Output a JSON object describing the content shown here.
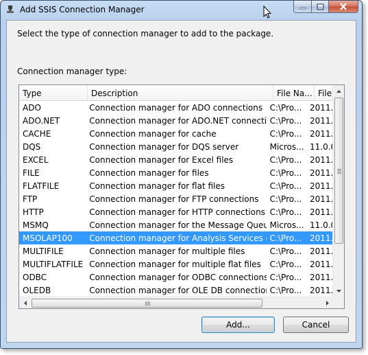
{
  "window": {
    "title": "Add SSIS Connection Manager"
  },
  "dialog": {
    "instruction": "Select the type of connection manager to add to the package.",
    "list_label": "Connection manager type:"
  },
  "list": {
    "columns": [
      "Type",
      "Description",
      "File Na...",
      "File V"
    ],
    "rows": [
      {
        "type": "ADO",
        "description": "Connection manager for ADO connections",
        "file_name": "C:\\Pro...",
        "file_version": "2011."
      },
      {
        "type": "ADO.NET",
        "description": "Connection manager for ADO.NET connections",
        "file_name": "C:\\Pro...",
        "file_version": "2011."
      },
      {
        "type": "CACHE",
        "description": "Connection manager for cache",
        "file_name": "C:\\Pro...",
        "file_version": "2011."
      },
      {
        "type": "DQS",
        "description": "Connection manager for DQS server",
        "file_name": "Micros...",
        "file_version": "11.0.0"
      },
      {
        "type": "EXCEL",
        "description": "Connection manager for Excel files",
        "file_name": "C:\\Pro...",
        "file_version": "2011."
      },
      {
        "type": "FILE",
        "description": "Connection manager for files",
        "file_name": "C:\\Pro...",
        "file_version": "2011."
      },
      {
        "type": "FLATFILE",
        "description": "Connection manager for flat files",
        "file_name": "C:\\Pro...",
        "file_version": "2011."
      },
      {
        "type": "FTP",
        "description": "Connection manager for FTP connections",
        "file_name": "C:\\Pro...",
        "file_version": "2011."
      },
      {
        "type": "HTTP",
        "description": "Connection manager for HTTP connections",
        "file_name": "C:\\Pro...",
        "file_version": "2011."
      },
      {
        "type": "MSMQ",
        "description": "Connection manager for the Message Queue t...",
        "file_name": "Micros...",
        "file_version": "11.0.0"
      },
      {
        "type": "MSOLAP100",
        "description": "Connection manager for Analysis Services con...",
        "file_name": "C:\\Pro...",
        "file_version": "2011."
      },
      {
        "type": "MULTIFILE",
        "description": "Connection manager for multiple files",
        "file_name": "C:\\Pro...",
        "file_version": "2011."
      },
      {
        "type": "MULTIFLATFILE",
        "description": "Connection manager for multiple flat files",
        "file_name": "C:\\Pro...",
        "file_version": "2011."
      },
      {
        "type": "ODBC",
        "description": "Connection manager for ODBC connections",
        "file_name": "C:\\Pro...",
        "file_version": "2011."
      },
      {
        "type": "OLEDB",
        "description": "Connection manager for OLE DB connections",
        "file_name": "C:\\Pro...",
        "file_version": "2011."
      }
    ],
    "selected_index": 10
  },
  "buttons": {
    "add": "Add...",
    "cancel": "Cancel"
  },
  "colors": {
    "selection": "#3399ff",
    "window_frame": "#b9d1ee",
    "close_button": "#c24d35"
  }
}
